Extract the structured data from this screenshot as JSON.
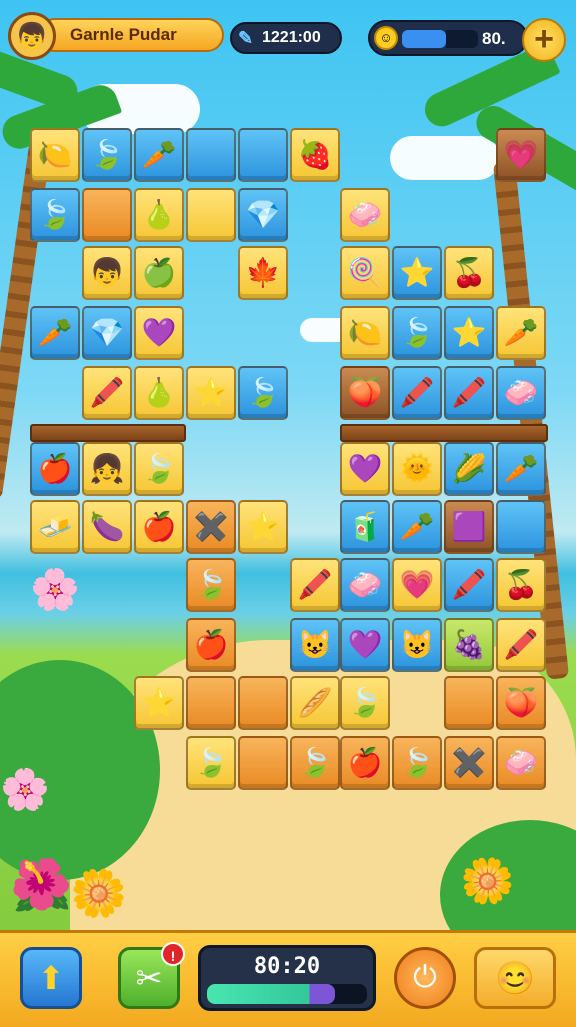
{
  "header": {
    "player_name": "Garnle Pudar",
    "score": "1221:00",
    "energy_value": "80.",
    "energy_level": 0.58
  },
  "footer": {
    "hint_badge": "!",
    "timer": "80:20",
    "timer_progress": 0.8
  },
  "icons": {
    "avatar": "player-avatar",
    "score": "feather-icon",
    "coin": "coin-icon",
    "plus": "plus-icon",
    "up": "arrow-up-icon",
    "hint": "shuffle-icon",
    "power": "power-icon",
    "character": "character-icon"
  },
  "tiles": [
    {
      "c": "y",
      "s": "🍋"
    },
    {
      "c": "b",
      "s": "🍃"
    },
    {
      "c": "b",
      "s": "🥕"
    },
    {
      "c": "b",
      "s": ""
    },
    {
      "c": "b",
      "s": ""
    },
    {
      "c": "y",
      "s": "🍓"
    },
    {
      "c": "d",
      "s": "💗"
    },
    {
      "c": "b",
      "s": "🍃"
    },
    {
      "c": "o",
      "s": ""
    },
    {
      "c": "y",
      "s": "🍐"
    },
    {
      "c": "y",
      "s": ""
    },
    {
      "c": "b",
      "s": "💎"
    },
    {
      "c": "y",
      "s": "🧼"
    },
    {
      "c": "y",
      "s": "👦"
    },
    {
      "c": "y",
      "s": "🍏"
    },
    {
      "c": "y",
      "s": "🍁"
    },
    {
      "c": "y",
      "s": "🍭"
    },
    {
      "c": "b",
      "s": "⭐"
    },
    {
      "c": "y",
      "s": "🍒"
    },
    {
      "c": "b",
      "s": "🥕"
    },
    {
      "c": "b",
      "s": "💎"
    },
    {
      "c": "y",
      "s": "💜"
    },
    {
      "c": "y",
      "s": "🍋"
    },
    {
      "c": "b",
      "s": "🍃"
    },
    {
      "c": "b",
      "s": "⭐"
    },
    {
      "c": "y",
      "s": "🥕"
    },
    {
      "c": "y",
      "s": "🖍️"
    },
    {
      "c": "y",
      "s": "🍐"
    },
    {
      "c": "y",
      "s": "⭐"
    },
    {
      "c": "b",
      "s": "🍃"
    },
    {
      "c": "d",
      "s": "🍑"
    },
    {
      "c": "b",
      "s": "🖍️"
    },
    {
      "c": "b",
      "s": "🖍️"
    },
    {
      "c": "b",
      "s": "🧼"
    },
    {
      "c": "b",
      "s": "🍎"
    },
    {
      "c": "y",
      "s": "👧"
    },
    {
      "c": "y",
      "s": "🍃"
    },
    {
      "c": "y",
      "s": "💜"
    },
    {
      "c": "y",
      "s": "🌞"
    },
    {
      "c": "b",
      "s": "🌽"
    },
    {
      "c": "b",
      "s": "🥕"
    },
    {
      "c": "y",
      "s": "🧈"
    },
    {
      "c": "y",
      "s": "🍆"
    },
    {
      "c": "y",
      "s": "🍎"
    },
    {
      "c": "o",
      "s": "✖️"
    },
    {
      "c": "y",
      "s": "⭐"
    },
    {
      "c": "b",
      "s": "🧃"
    },
    {
      "c": "b",
      "s": "🥕"
    },
    {
      "c": "d",
      "s": "🟪"
    },
    {
      "c": "b",
      "s": ""
    },
    {
      "c": "o",
      "s": "🍃"
    },
    {
      "c": "y",
      "s": "🖍️"
    },
    {
      "c": "b",
      "s": "🧼"
    },
    {
      "c": "y",
      "s": "💗"
    },
    {
      "c": "b",
      "s": "🖍️"
    },
    {
      "c": "y",
      "s": "🍒"
    },
    {
      "c": "o",
      "s": "🍎"
    },
    {
      "c": "b",
      "s": "😺"
    },
    {
      "c": "b",
      "s": "💜"
    },
    {
      "c": "b",
      "s": "😺"
    },
    {
      "c": "g",
      "s": "🍇"
    },
    {
      "c": "y",
      "s": "🖍️"
    },
    {
      "c": "y",
      "s": "⭐"
    },
    {
      "c": "o",
      "s": ""
    },
    {
      "c": "o",
      "s": ""
    },
    {
      "c": "y",
      "s": "🥖"
    },
    {
      "c": "y",
      "s": "🍃"
    },
    {
      "c": "o",
      "s": ""
    },
    {
      "c": "o",
      "s": "🍑"
    },
    {
      "c": "y",
      "s": "🍃"
    },
    {
      "c": "o",
      "s": ""
    },
    {
      "c": "o",
      "s": "🍃"
    },
    {
      "c": "o",
      "s": "🍎"
    },
    {
      "c": "o",
      "s": "🍃"
    },
    {
      "c": "o",
      "s": "✖️"
    },
    {
      "c": "o",
      "s": "🧼"
    }
  ]
}
